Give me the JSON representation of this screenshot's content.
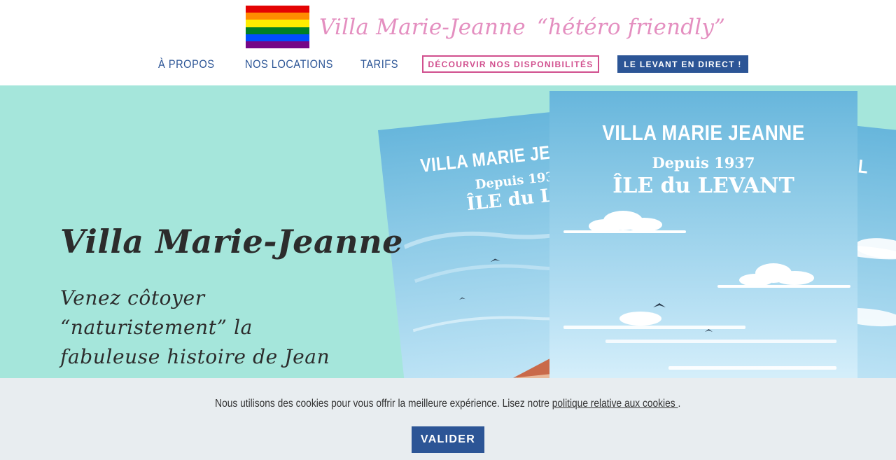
{
  "header": {
    "flag_colors": [
      "#e40303",
      "#ff8c00",
      "#ffed00",
      "#008026",
      "#004dff",
      "#750787"
    ],
    "site_name": "Villa Marie-Jeanne",
    "tagline": "“hétéro friendly”"
  },
  "nav": {
    "about": "À PROPOS",
    "rentals": "NOS LOCATIONS",
    "rates": "TARIFS",
    "availability": "DÉCOURVIR NOS DISPONIBILITÉS",
    "live": "LE LEVANT EN DIRECT !"
  },
  "hero": {
    "title": "Villa Marie-Jeanne",
    "text": "Venez côtoyer “naturistement” la fabuleuse histoire de Jean"
  },
  "posters": {
    "title": "VILLA MARIE JEANNE",
    "left_title": "VILLA MARIE JE",
    "right_title": "VIL",
    "since": "Depuis 1937",
    "island": "ÎLE du LEVANT",
    "left_island": "ÎLE du LEVA"
  },
  "cookie": {
    "text_before": "Nous utilisons des cookies pour vous offrir la meilleure expérience. Lisez notre ",
    "link": "politique relative aux cookies ",
    "text_after": ".",
    "button": "VALIDER"
  }
}
